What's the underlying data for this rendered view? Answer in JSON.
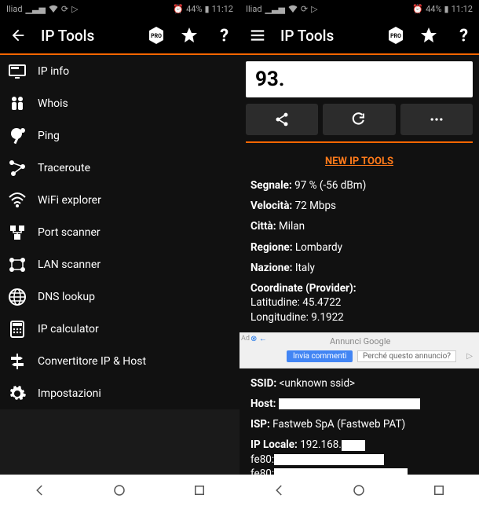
{
  "statusbar": {
    "carrier": "Iliad",
    "battery": "44%",
    "time": "11:12"
  },
  "app": {
    "title": "IP Tools"
  },
  "menu": {
    "items": [
      {
        "label": "IP info",
        "icon": "monitor-icon"
      },
      {
        "label": "Whois",
        "icon": "people-icon"
      },
      {
        "label": "Ping",
        "icon": "pingpong-icon"
      },
      {
        "label": "Traceroute",
        "icon": "route-icon"
      },
      {
        "label": "WiFi explorer",
        "icon": "wifi-icon"
      },
      {
        "label": "Port scanner",
        "icon": "ports-icon"
      },
      {
        "label": "LAN scanner",
        "icon": "lan-icon"
      },
      {
        "label": "DNS lookup",
        "icon": "globe-icon"
      },
      {
        "label": "IP calculator",
        "icon": "calculator-icon"
      },
      {
        "label": "Convertitore IP & Host",
        "icon": "signpost-icon"
      },
      {
        "label": "Impostazioni",
        "icon": "gear-icon"
      }
    ]
  },
  "ipinfo": {
    "ip_prefix": "93.",
    "link_label": "NEW IP TOOLS",
    "signal_label": "Segnale:",
    "signal_value": "97 % (-56 dBm)",
    "speed_label": "Velocità:",
    "speed_value": "72 Mbps",
    "city_label": "Città:",
    "city_value": "Milan",
    "region_label": "Regione:",
    "region_value": "Lombardy",
    "nation_label": "Nazione:",
    "nation_value": "Italy",
    "coord_label": "Coordinate (Provider):",
    "lat_label": "Latitudine: 45.4722",
    "lon_label": "Longitudine: 9.1922",
    "ssid_label": "SSID:",
    "ssid_value": "<unknown ssid>",
    "host_label": "Host:",
    "isp_label": "ISP:",
    "isp_value": "Fastweb SpA (Fastweb PAT)",
    "iplocal_label": "IP Locale:",
    "iplocal_value": "192.168.",
    "ipv6_1": "fe80:",
    "ipv6_2": "fe80:"
  },
  "ad": {
    "ad_label": "Ad",
    "google_text": "Annunci Google",
    "btn1": "Invia commenti",
    "btn2": "Perché questo annuncio?"
  }
}
